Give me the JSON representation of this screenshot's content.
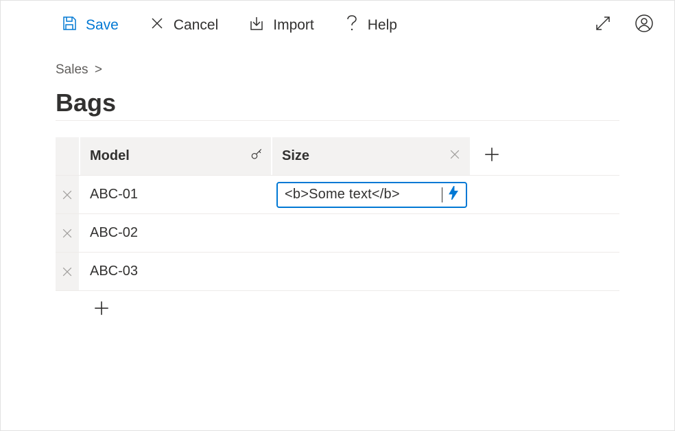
{
  "toolbar": {
    "save": "Save",
    "cancel": "Cancel",
    "import": "Import",
    "help": "Help"
  },
  "breadcrumb": {
    "parent": "Sales",
    "separator": ">"
  },
  "page_title": "Bags",
  "grid": {
    "columns": {
      "model": "Model",
      "size": "Size"
    },
    "rows": [
      {
        "model": "ABC-01",
        "size": "<b>Some text</b>",
        "editing": true
      },
      {
        "model": "ABC-02",
        "size": ""
      },
      {
        "model": "ABC-03",
        "size": ""
      }
    ]
  }
}
